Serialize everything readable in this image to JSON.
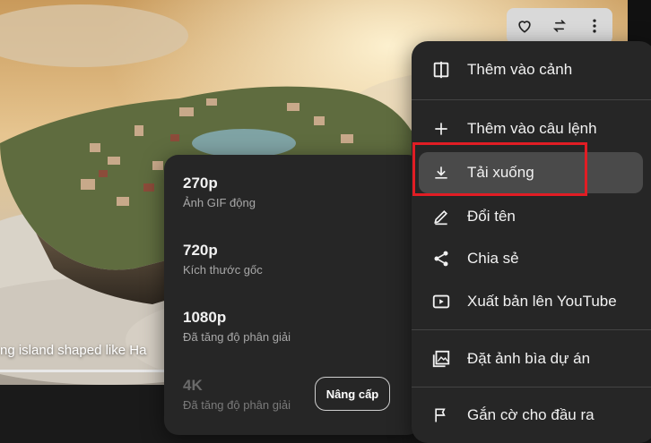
{
  "video": {
    "caption": "ng island shaped like Ha"
  },
  "top_actions": {
    "icons": [
      "heart-icon",
      "repeat-icon",
      "more-vert-icon"
    ]
  },
  "menu": {
    "items": [
      {
        "label": "Thêm vào cảnh",
        "icon": "scene-add-icon"
      },
      {
        "label": "Thêm vào câu lệnh",
        "icon": "plus-icon"
      },
      {
        "label": "Tải xuống",
        "icon": "download-icon"
      },
      {
        "label": "Đổi tên",
        "icon": "pencil-icon"
      },
      {
        "label": "Chia sẻ",
        "icon": "share-icon"
      },
      {
        "label": "Xuất bản lên YouTube",
        "icon": "youtube-icon"
      },
      {
        "label": "Đặt ảnh bìa dự án",
        "icon": "image-icon"
      },
      {
        "label": "Gắn cờ cho đầu ra",
        "icon": "flag-icon"
      }
    ]
  },
  "download_options": [
    {
      "title": "270p",
      "subtitle": "Ảnh GIF động"
    },
    {
      "title": "720p",
      "subtitle": "Kích thước gốc"
    },
    {
      "title": "1080p",
      "subtitle": "Đã tăng độ phân giải"
    },
    {
      "title": "4K",
      "subtitle": "Đã tăng độ phân giải",
      "upgrade_label": "Nâng cấp"
    }
  ],
  "colors": {
    "menu_bg": "#262626",
    "highlight_border": "#e11d24",
    "active_item": "#4a4a4a"
  }
}
